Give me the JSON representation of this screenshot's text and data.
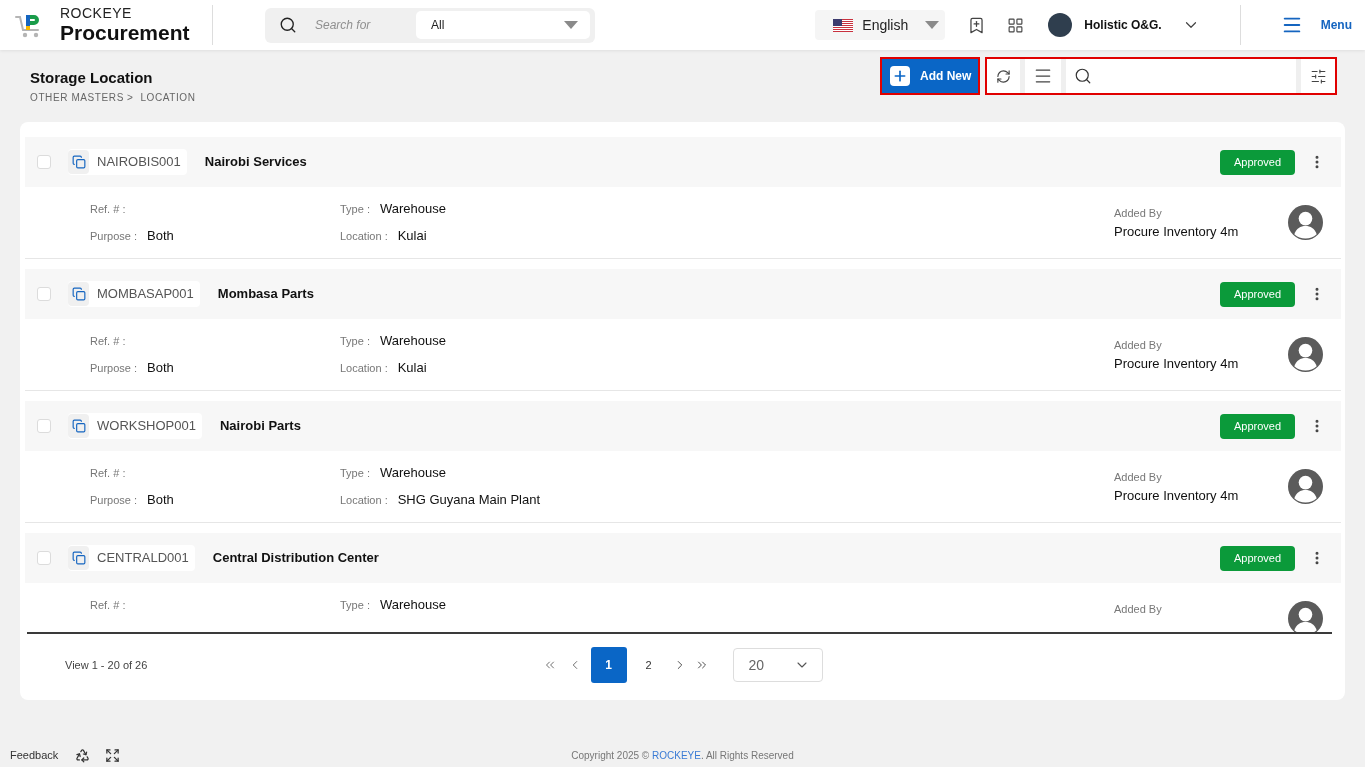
{
  "header": {
    "brand": {
      "label": "ROCKEYE",
      "title": "Procurement"
    },
    "search": {
      "placeholder": "Search for",
      "scope": "All"
    },
    "language": "English",
    "user": {
      "name": "Holistic O&G."
    },
    "menu_label": "Menu"
  },
  "page": {
    "title": "Storage Location",
    "breadcrumb": {
      "items": [
        "OTHER MASTERS",
        "LOCATION"
      ],
      "separator": ">"
    },
    "add_button": "Add New"
  },
  "records": [
    {
      "checked": false,
      "code": "NAIROBIS001",
      "name": "Nairobi Services",
      "status": "Approved",
      "fields": [
        {
          "label": "Ref. # :"
        },
        {
          "label": "Type :",
          "value": "Warehouse"
        },
        {
          "label": "Purpose :",
          "value": "Both"
        },
        {
          "label": "Location :",
          "value": "Kulai"
        }
      ],
      "added_by": {
        "label": "Added By",
        "name": "Procure Inventory 4m"
      }
    },
    {
      "checked": false,
      "code": "MOMBASAP001",
      "name": "Mombasa Parts",
      "status": "Approved",
      "fields": [
        {
          "label": "Ref. # :"
        },
        {
          "label": "Type :",
          "value": "Warehouse"
        },
        {
          "label": "Purpose :",
          "value": "Both"
        },
        {
          "label": "Location :",
          "value": "Kulai"
        }
      ],
      "added_by": {
        "label": "Added By",
        "name": "Procure Inventory 4m"
      }
    },
    {
      "checked": false,
      "code": "WORKSHOP001",
      "name": "Nairobi Parts",
      "status": "Approved",
      "fields": [
        {
          "label": "Ref. # :"
        },
        {
          "label": "Type :",
          "value": "Warehouse"
        },
        {
          "label": "Purpose :",
          "value": "Both"
        },
        {
          "label": "Location :",
          "value": "SHG Guyana Main Plant"
        }
      ],
      "added_by": {
        "label": "Added By",
        "name": "Procure Inventory 4m"
      }
    },
    {
      "checked": false,
      "code": "CENTRALD001",
      "name": "Central Distribution Center",
      "status": "Approved",
      "fields": [
        {
          "label": "Ref. # :"
        },
        {
          "label": "Type :",
          "value": "Warehouse"
        }
      ],
      "added_by": {
        "label": "Added By"
      }
    }
  ],
  "pagination": {
    "summary": "View 1 - 20 of 26",
    "pages": [
      {
        "label": "1",
        "selected": true
      },
      {
        "label": "2",
        "selected": false
      }
    ],
    "page_size": "20"
  },
  "footer": {
    "feedback": "Feedback",
    "copyright": {
      "prefix": "Copyright 2025 © ",
      "link": "ROCKEYE",
      "suffix": ". All Rights Reserved"
    }
  }
}
